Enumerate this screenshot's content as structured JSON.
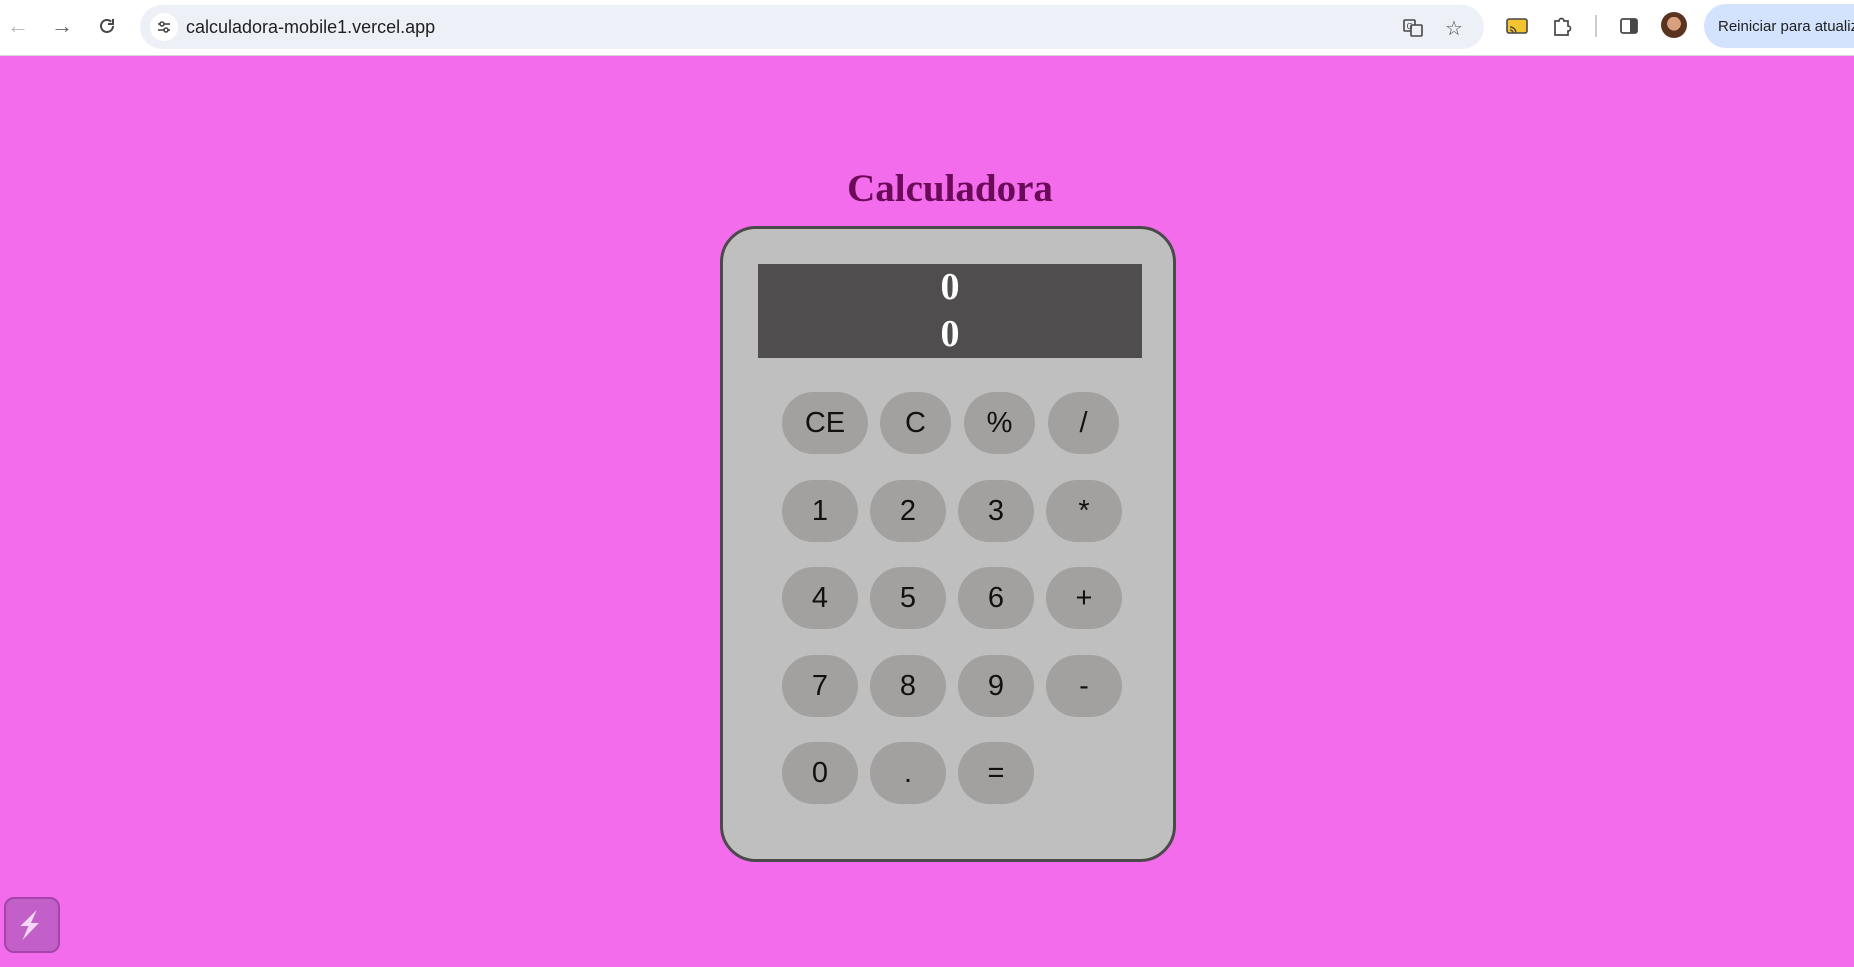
{
  "browser": {
    "url": "calculadora-mobile1.vercel.app",
    "restart_label": "Reiniciar para atualizar"
  },
  "page": {
    "title": "Calculadora"
  },
  "calculator": {
    "display": {
      "previous": "0",
      "current": "0"
    },
    "keys": {
      "ce": "CE",
      "c": "C",
      "percent": "%",
      "divide": "/",
      "one": "1",
      "two": "2",
      "three": "3",
      "multiply": "*",
      "four": "4",
      "five": "5",
      "six": "6",
      "plus": "+",
      "seven": "7",
      "eight": "8",
      "nine": "9",
      "minus": "-",
      "zero": "0",
      "dot": ".",
      "equals": "="
    }
  },
  "colors": {
    "page_background": "#f26cec",
    "title": "#6a0a58",
    "calculator_body": "#bfbfbf",
    "display_background": "#4f4d4d",
    "key_background": "#a2a19f"
  },
  "icons": {
    "back": "arrow-left-icon",
    "forward": "arrow-right-icon",
    "reload": "reload-icon",
    "site_info": "tune-icon",
    "translate": "translate-icon",
    "bookmark": "star-icon",
    "cast": "cast-icon",
    "extensions": "puzzle-icon",
    "side_panel": "side-panel-icon",
    "widget": "lightning-icon"
  }
}
